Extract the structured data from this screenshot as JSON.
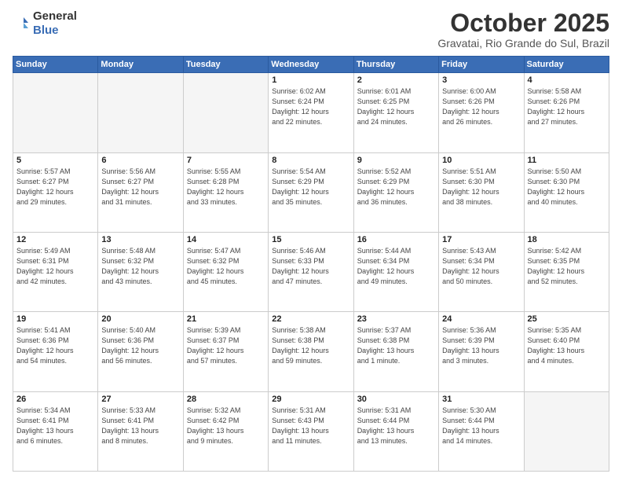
{
  "header": {
    "logo_general": "General",
    "logo_blue": "Blue",
    "title": "October 2025",
    "location": "Gravatai, Rio Grande do Sul, Brazil"
  },
  "weekdays": [
    "Sunday",
    "Monday",
    "Tuesday",
    "Wednesday",
    "Thursday",
    "Friday",
    "Saturday"
  ],
  "weeks": [
    [
      {
        "day": "",
        "info": ""
      },
      {
        "day": "",
        "info": ""
      },
      {
        "day": "",
        "info": ""
      },
      {
        "day": "1",
        "info": "Sunrise: 6:02 AM\nSunset: 6:24 PM\nDaylight: 12 hours\nand 22 minutes."
      },
      {
        "day": "2",
        "info": "Sunrise: 6:01 AM\nSunset: 6:25 PM\nDaylight: 12 hours\nand 24 minutes."
      },
      {
        "day": "3",
        "info": "Sunrise: 6:00 AM\nSunset: 6:26 PM\nDaylight: 12 hours\nand 26 minutes."
      },
      {
        "day": "4",
        "info": "Sunrise: 5:58 AM\nSunset: 6:26 PM\nDaylight: 12 hours\nand 27 minutes."
      }
    ],
    [
      {
        "day": "5",
        "info": "Sunrise: 5:57 AM\nSunset: 6:27 PM\nDaylight: 12 hours\nand 29 minutes."
      },
      {
        "day": "6",
        "info": "Sunrise: 5:56 AM\nSunset: 6:27 PM\nDaylight: 12 hours\nand 31 minutes."
      },
      {
        "day": "7",
        "info": "Sunrise: 5:55 AM\nSunset: 6:28 PM\nDaylight: 12 hours\nand 33 minutes."
      },
      {
        "day": "8",
        "info": "Sunrise: 5:54 AM\nSunset: 6:29 PM\nDaylight: 12 hours\nand 35 minutes."
      },
      {
        "day": "9",
        "info": "Sunrise: 5:52 AM\nSunset: 6:29 PM\nDaylight: 12 hours\nand 36 minutes."
      },
      {
        "day": "10",
        "info": "Sunrise: 5:51 AM\nSunset: 6:30 PM\nDaylight: 12 hours\nand 38 minutes."
      },
      {
        "day": "11",
        "info": "Sunrise: 5:50 AM\nSunset: 6:30 PM\nDaylight: 12 hours\nand 40 minutes."
      }
    ],
    [
      {
        "day": "12",
        "info": "Sunrise: 5:49 AM\nSunset: 6:31 PM\nDaylight: 12 hours\nand 42 minutes."
      },
      {
        "day": "13",
        "info": "Sunrise: 5:48 AM\nSunset: 6:32 PM\nDaylight: 12 hours\nand 43 minutes."
      },
      {
        "day": "14",
        "info": "Sunrise: 5:47 AM\nSunset: 6:32 PM\nDaylight: 12 hours\nand 45 minutes."
      },
      {
        "day": "15",
        "info": "Sunrise: 5:46 AM\nSunset: 6:33 PM\nDaylight: 12 hours\nand 47 minutes."
      },
      {
        "day": "16",
        "info": "Sunrise: 5:44 AM\nSunset: 6:34 PM\nDaylight: 12 hours\nand 49 minutes."
      },
      {
        "day": "17",
        "info": "Sunrise: 5:43 AM\nSunset: 6:34 PM\nDaylight: 12 hours\nand 50 minutes."
      },
      {
        "day": "18",
        "info": "Sunrise: 5:42 AM\nSunset: 6:35 PM\nDaylight: 12 hours\nand 52 minutes."
      }
    ],
    [
      {
        "day": "19",
        "info": "Sunrise: 5:41 AM\nSunset: 6:36 PM\nDaylight: 12 hours\nand 54 minutes."
      },
      {
        "day": "20",
        "info": "Sunrise: 5:40 AM\nSunset: 6:36 PM\nDaylight: 12 hours\nand 56 minutes."
      },
      {
        "day": "21",
        "info": "Sunrise: 5:39 AM\nSunset: 6:37 PM\nDaylight: 12 hours\nand 57 minutes."
      },
      {
        "day": "22",
        "info": "Sunrise: 5:38 AM\nSunset: 6:38 PM\nDaylight: 12 hours\nand 59 minutes."
      },
      {
        "day": "23",
        "info": "Sunrise: 5:37 AM\nSunset: 6:38 PM\nDaylight: 13 hours\nand 1 minute."
      },
      {
        "day": "24",
        "info": "Sunrise: 5:36 AM\nSunset: 6:39 PM\nDaylight: 13 hours\nand 3 minutes."
      },
      {
        "day": "25",
        "info": "Sunrise: 5:35 AM\nSunset: 6:40 PM\nDaylight: 13 hours\nand 4 minutes."
      }
    ],
    [
      {
        "day": "26",
        "info": "Sunrise: 5:34 AM\nSunset: 6:41 PM\nDaylight: 13 hours\nand 6 minutes."
      },
      {
        "day": "27",
        "info": "Sunrise: 5:33 AM\nSunset: 6:41 PM\nDaylight: 13 hours\nand 8 minutes."
      },
      {
        "day": "28",
        "info": "Sunrise: 5:32 AM\nSunset: 6:42 PM\nDaylight: 13 hours\nand 9 minutes."
      },
      {
        "day": "29",
        "info": "Sunrise: 5:31 AM\nSunset: 6:43 PM\nDaylight: 13 hours\nand 11 minutes."
      },
      {
        "day": "30",
        "info": "Sunrise: 5:31 AM\nSunset: 6:44 PM\nDaylight: 13 hours\nand 13 minutes."
      },
      {
        "day": "31",
        "info": "Sunrise: 5:30 AM\nSunset: 6:44 PM\nDaylight: 13 hours\nand 14 minutes."
      },
      {
        "day": "",
        "info": ""
      }
    ]
  ]
}
